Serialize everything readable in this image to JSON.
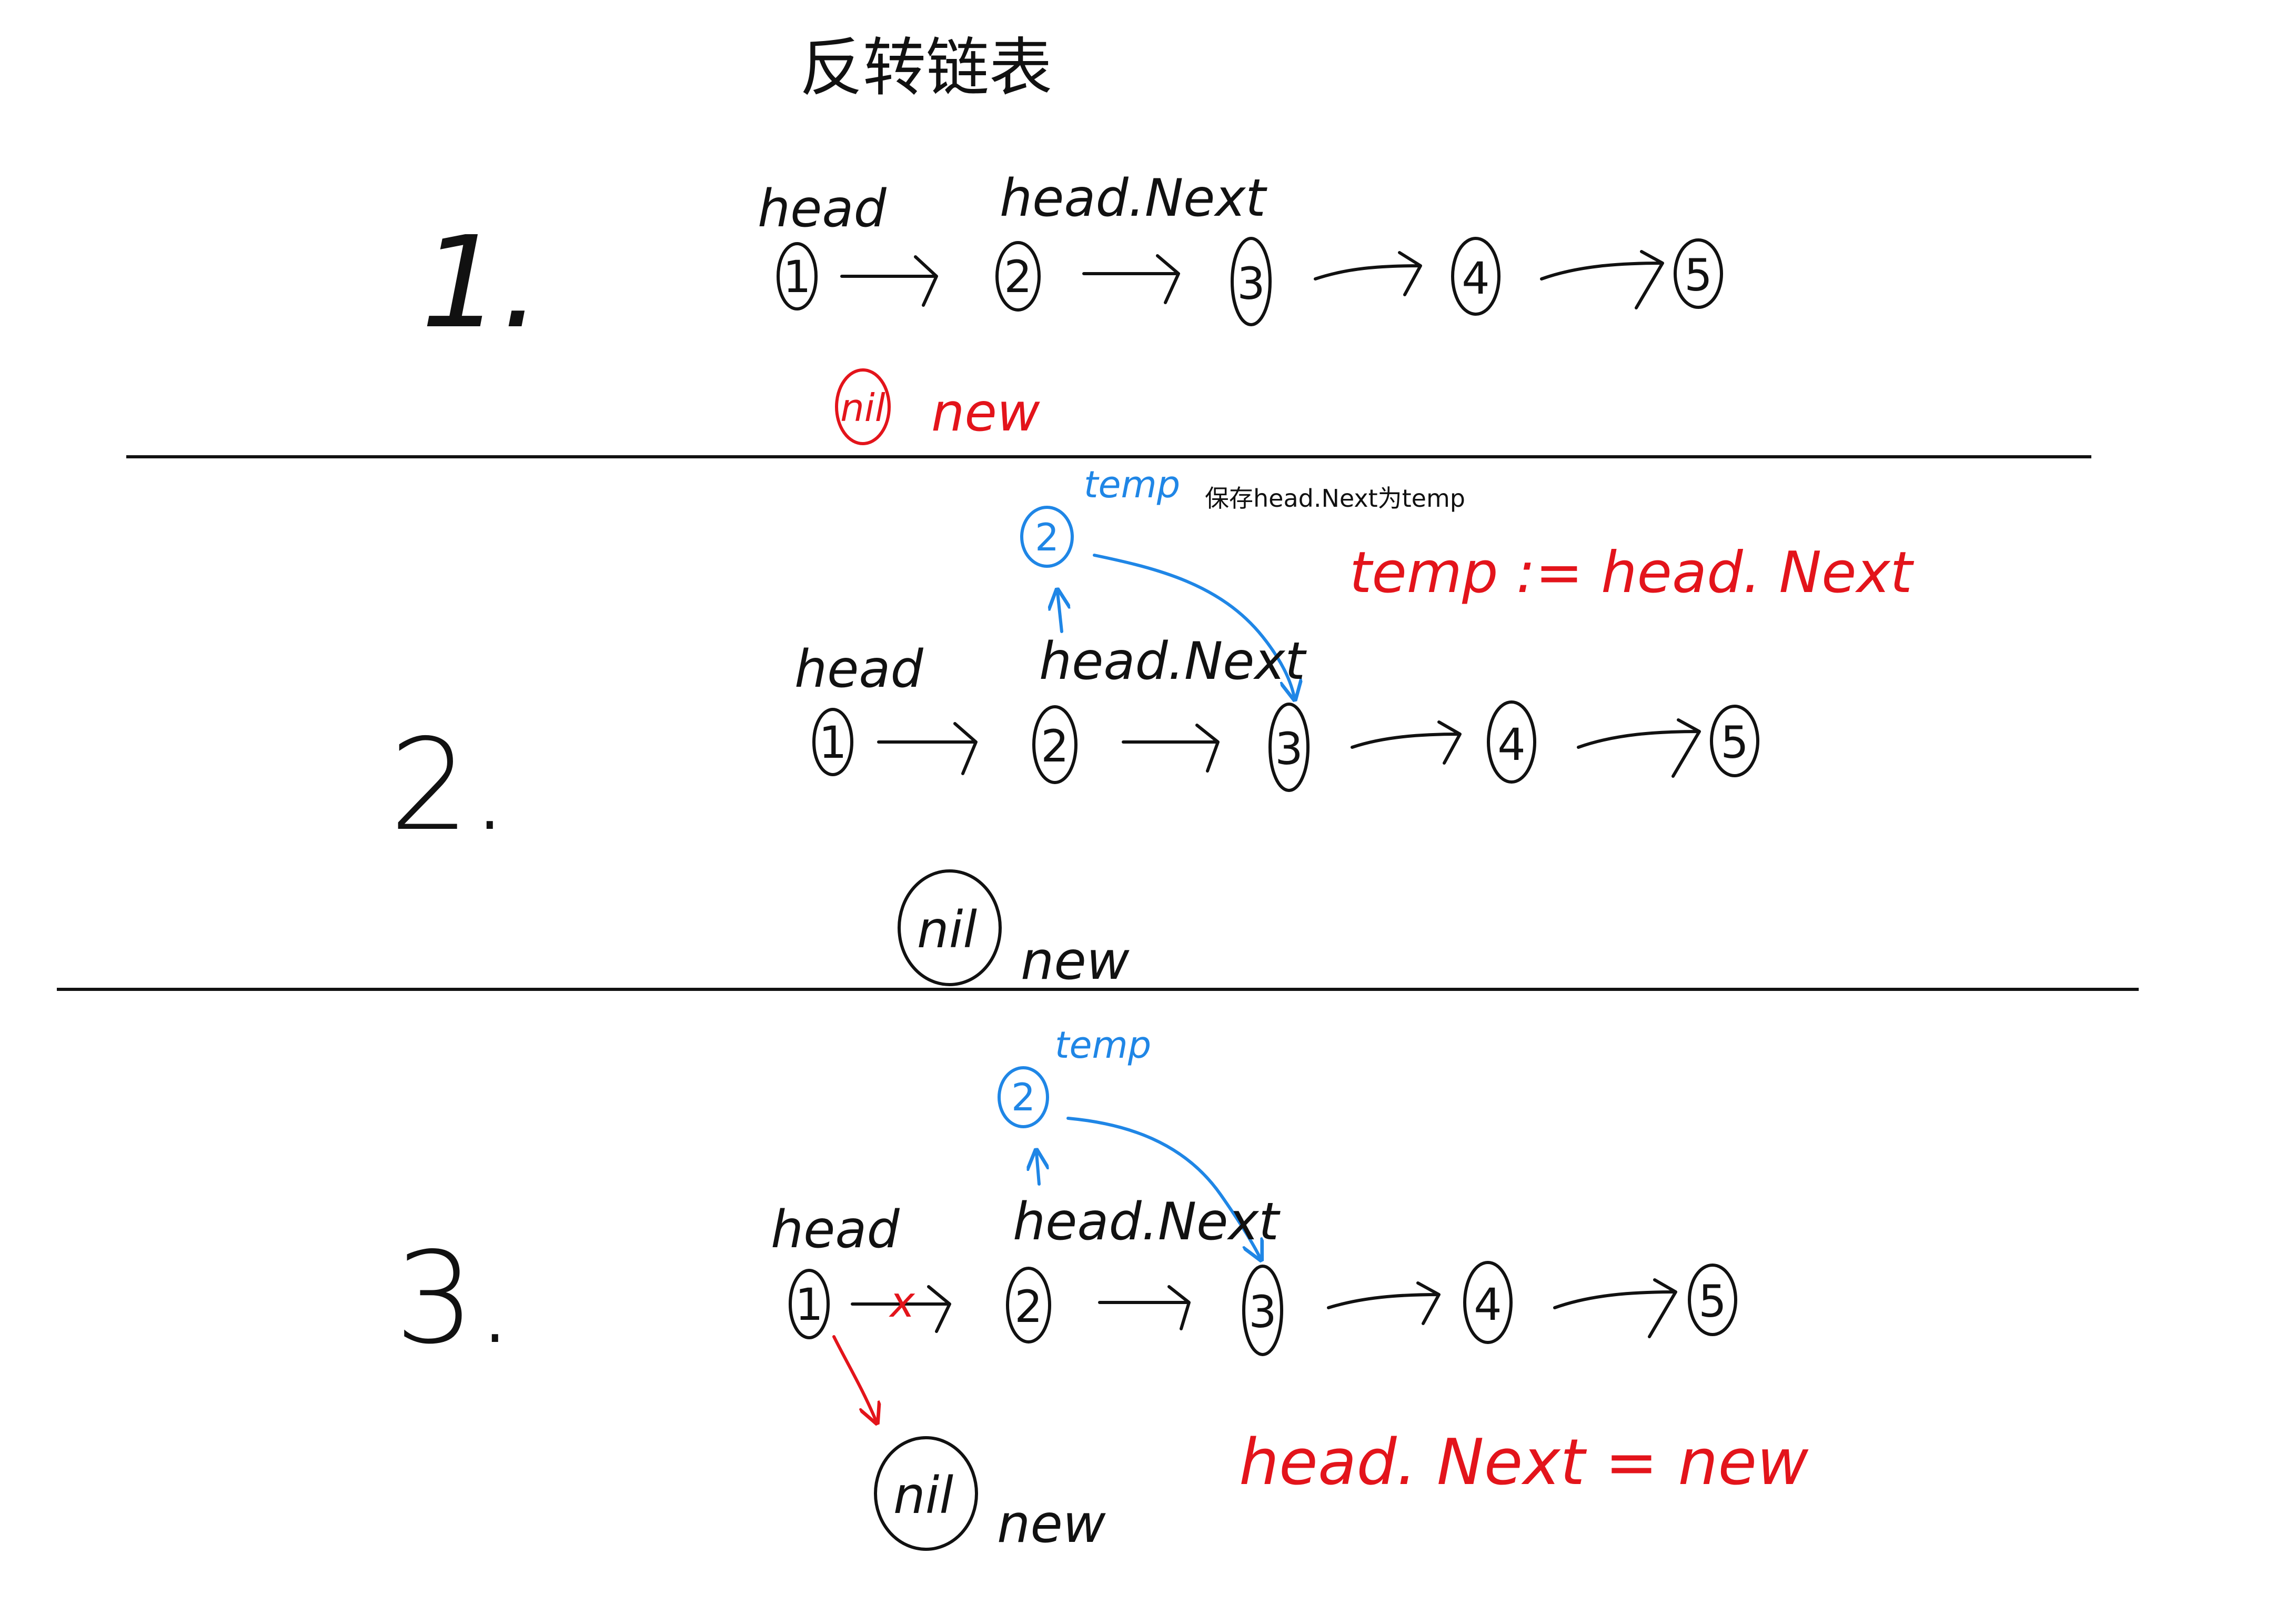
{
  "title": "反转链表",
  "colors": {
    "black": "#111111",
    "red": "#e3141b",
    "blue": "#1f86e6"
  },
  "steps": [
    {
      "number": "1.",
      "nodes": [
        "1",
        "2",
        "3",
        "4",
        "5"
      ],
      "head_label": "head",
      "next_label": "head.Next",
      "nil_label": "nil",
      "new_label": "new"
    },
    {
      "number": "2.",
      "nodes": [
        "1",
        "2",
        "3",
        "4",
        "5"
      ],
      "head_label": "head",
      "next_label": "head.Next",
      "nil_label": "nil",
      "new_label": "new",
      "temp_node": "2",
      "temp_label": "temp",
      "note": "保存head.Next为temp",
      "code": "temp := head. Next"
    },
    {
      "number": "3.",
      "nodes": [
        "1",
        "2",
        "3",
        "4",
        "5"
      ],
      "head_label": "head",
      "next_label": "head.Next",
      "nil_label": "nil",
      "new_label": "new",
      "temp_node": "2",
      "temp_label": "temp",
      "cross_mark": "x",
      "code": "head. Next = new"
    }
  ]
}
